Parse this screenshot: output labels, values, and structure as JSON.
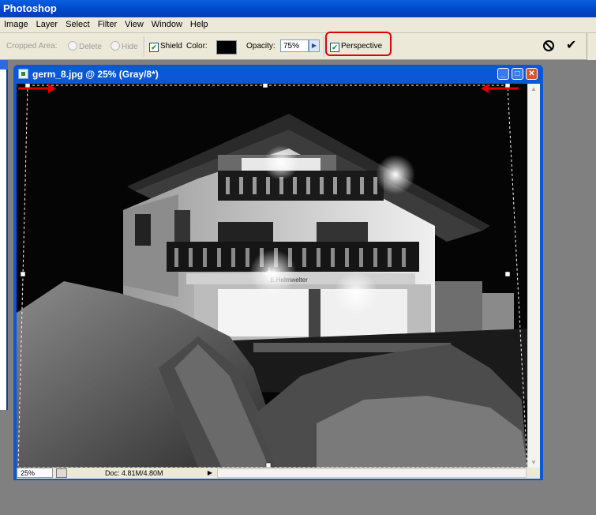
{
  "app": {
    "title": "Photoshop"
  },
  "menu": {
    "items": [
      "Image",
      "Layer",
      "Select",
      "Filter",
      "View",
      "Window",
      "Help"
    ]
  },
  "options": {
    "cropped_area_label": "Cropped Area:",
    "delete_label": "Delete",
    "hide_label": "Hide",
    "shield_label": "Shield",
    "shield_checked": true,
    "color_label": "Color:",
    "color_value": "#000000",
    "opacity_label": "Opacity:",
    "opacity_value": "75%",
    "perspective_label": "Perspective",
    "perspective_checked": true,
    "highlight_color": "#e00000"
  },
  "document": {
    "title": "germ_8.jpg @ 25% (Gray/8*)",
    "zoom": "25%",
    "doc_info": "Doc: 4.81M/4.80M",
    "sign_text": "E.Helmwelter",
    "arrow_color": "#e00000"
  },
  "icons": {
    "cancel": "cancel-icon",
    "commit": "commit-icon",
    "checkmark": "✔"
  }
}
